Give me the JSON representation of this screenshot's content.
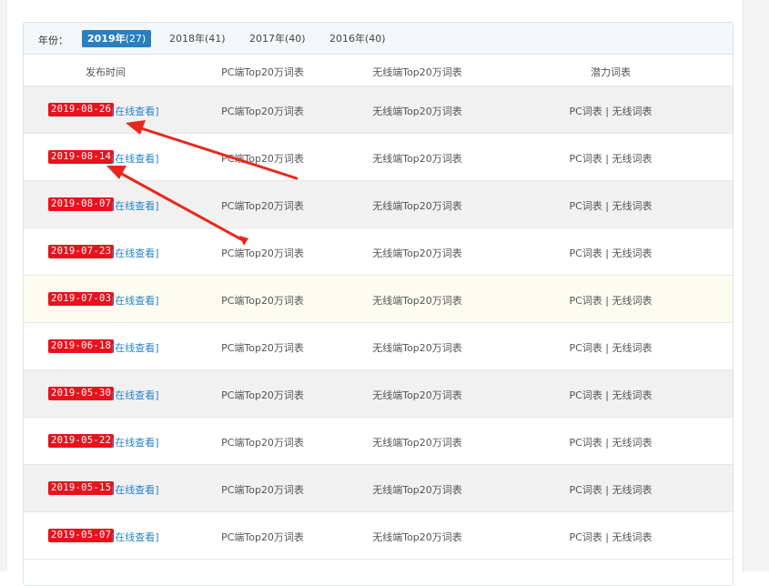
{
  "year_filter": {
    "label": "年份：",
    "tabs": [
      {
        "year": "2019年",
        "count": "(27)",
        "active": true
      },
      {
        "year": "2018年",
        "count": "(41)",
        "active": false
      },
      {
        "year": "2017年",
        "count": "(40)",
        "active": false
      },
      {
        "year": "2016年",
        "count": "(40)",
        "active": false
      }
    ]
  },
  "table": {
    "headers": [
      "发布时间",
      "PC端Top20万词表",
      "无线端Top20万词表",
      "潜力词表"
    ],
    "view_link_text": "[在线查看]",
    "pc_link_text": "PC端Top20万词表",
    "wx_link_text": "无线端Top20万词表",
    "pot_pc_text": "PC词表",
    "pot_sep": " | ",
    "pot_wx_text": "无线词表",
    "rows": [
      {
        "date": "2019-08-26"
      },
      {
        "date": "2019-08-14"
      },
      {
        "date": "2019-08-07"
      },
      {
        "date": "2019-07-23"
      },
      {
        "date": "2019-07-03"
      },
      {
        "date": "2019-06-18"
      },
      {
        "date": "2019-05-30"
      },
      {
        "date": "2019-05-22"
      },
      {
        "date": "2019-05-15"
      },
      {
        "date": "2019-05-07"
      }
    ]
  },
  "colors": {
    "accent": "#2a7fc0",
    "date_badge": "#e8121d",
    "link": "#2a82c7",
    "annotation_arrow": "#e8281c"
  }
}
